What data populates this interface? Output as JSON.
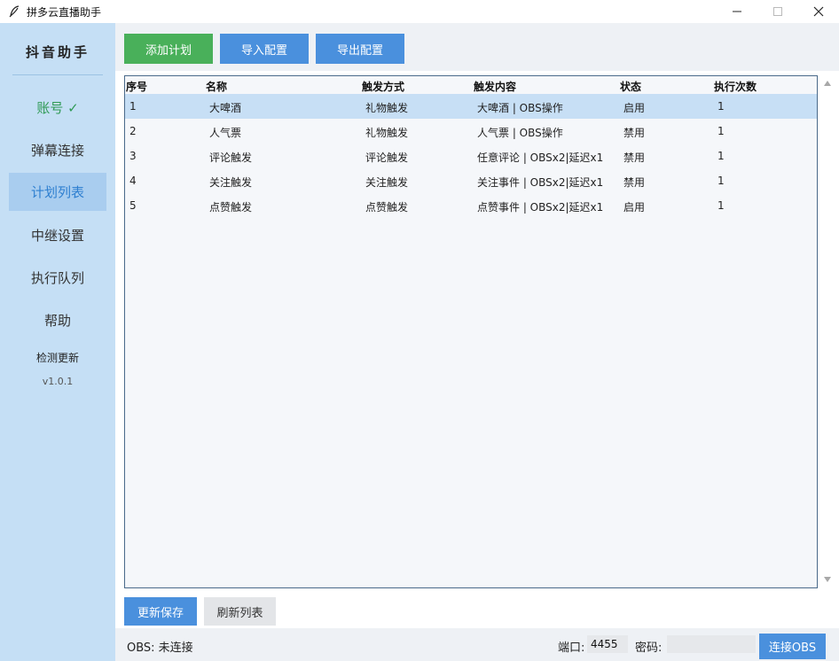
{
  "window": {
    "title": "拼多云直播助手"
  },
  "sidebar": {
    "brand": "抖音助手",
    "items": [
      {
        "label": "账号 ✓"
      },
      {
        "label": "弹幕连接"
      },
      {
        "label": "计划列表"
      },
      {
        "label": "中继设置"
      },
      {
        "label": "执行队列"
      },
      {
        "label": "帮助"
      }
    ],
    "update_label": "检测更新",
    "version": "v1.0.1"
  },
  "toolbar": {
    "add_plan": "添加计划",
    "import_config": "导入配置",
    "export_config": "导出配置"
  },
  "table": {
    "columns": [
      "序号",
      "名称",
      "触发方式",
      "触发内容",
      "状态",
      "执行次数"
    ],
    "rows": [
      [
        "1",
        "大啤酒",
        "礼物触发",
        "大啤酒 | OBS操作",
        "启用",
        "1"
      ],
      [
        "2",
        "人气票",
        "礼物触发",
        "人气票 | OBS操作",
        "禁用",
        "1"
      ],
      [
        "3",
        "评论触发",
        "评论触发",
        "任意评论 | OBSx2|延迟x1",
        "禁用",
        "1"
      ],
      [
        "4",
        "关注触发",
        "关注触发",
        "关注事件 | OBSx2|延迟x1",
        "禁用",
        "1"
      ],
      [
        "5",
        "点赞触发",
        "点赞触发",
        "点赞事件 | OBSx2|延迟x1",
        "启用",
        "1"
      ]
    ]
  },
  "actions": {
    "save": "更新保存",
    "refresh": "刷新列表"
  },
  "status": {
    "obs_status": "OBS: 未连接",
    "port_label": "端口:",
    "port_value": "4455",
    "password_label": "密码:",
    "password_value": "",
    "connect_button": "连接OBS"
  }
}
